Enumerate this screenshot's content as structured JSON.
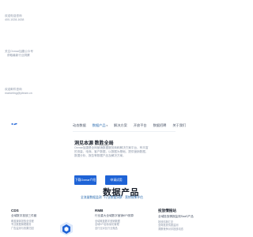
{
  "contact": {
    "phone_label": "欢迎电话咨询",
    "phone_number": "400-1028-1638",
    "wechat_label": "关注Oxmar加唐公众号",
    "wechat_desc": "获取最新行业洞察",
    "email_label": "欢迎邮件咨询",
    "email_address": "marketing@yiteam.cn"
  },
  "nav": {
    "items": [
      {
        "label": "动态数据",
        "active": false
      },
      {
        "label": "数据产品",
        "active": true,
        "caret": "▾"
      },
      {
        "label": "解决方案",
        "active": false
      },
      {
        "label": "开放平台",
        "active": false
      },
      {
        "label": "数据招聘",
        "active": false
      },
      {
        "label": "关于我们",
        "active": false
      }
    ]
  },
  "hero": {
    "title": "洞见本源 数胜全局",
    "description": "Oxmar加唐是全网营销数据服务商和解决方案平台，有丰富的流量、电商、客户数据，以数据为基础，提供营销数据、数据分析、报告等数据产品及解决方案。",
    "primary_button": "下载Oxmar介绍",
    "secondary_button": "申请试用"
  },
  "section": {
    "title": "数据产品",
    "subtitle": "全流量数据监测 · 行业数据洞察 · 营销效果评估"
  },
  "products": [
    {
      "title": "CDS",
      "subtitle": "全域数字投放三件套",
      "desc": [
        "覆盖媒体投放全流程",
        "专业数据管理服务",
        "广告监测与效果归因"
      ]
    },
    {
      "title": "RMB",
      "subtitle": "行业重大全域数字营销KPI测算",
      "desc": [
        "全域覆盖数字营销数据",
        "全域KPI目标量化管理",
        "全行业对比行业竞品"
      ]
    },
    {
      "title": "投放情报站",
      "subtitle": "全域投放情报监测SaaS产品",
      "desc": [
        "投放情报汇总",
        "全网投放情报监测",
        "洞察竞争对手投放动态"
      ]
    }
  ],
  "colors": {
    "accent": "#1e63d6",
    "heading": "#1a202c",
    "muted": "#8a94a6",
    "link": "#2b6cb0"
  }
}
